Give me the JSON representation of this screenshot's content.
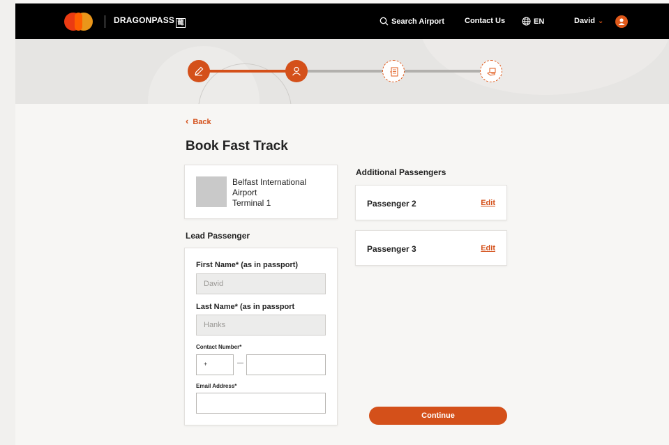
{
  "brand": {
    "name": "DRAGONPASS",
    "badge": "龍"
  },
  "nav": {
    "search_label": "Search Airport",
    "contact_label": "Contact Us",
    "language_label": "EN",
    "user_label": "David"
  },
  "stepper": {
    "steps": [
      {
        "icon": "pencil-icon",
        "state": "done"
      },
      {
        "icon": "person-icon",
        "state": "active"
      },
      {
        "icon": "document-icon",
        "state": "pending"
      },
      {
        "icon": "payment-icon",
        "state": "pending"
      }
    ],
    "accent_color": "#d4501a"
  },
  "page": {
    "back_label": "Back",
    "title": "Book Fast Track"
  },
  "airport": {
    "line1": "Belfast International",
    "line2": "Airport",
    "line3": "Terminal 1"
  },
  "lead": {
    "section_label": "Lead Passenger",
    "first_name_label": "First Name* (as in passport)",
    "first_name_value": "David",
    "last_name_label": "Last Name* (as in passport",
    "last_name_value": "Hanks",
    "contact_label": "Contact Number*",
    "contact_code_value": "+",
    "email_label": "Email Address*"
  },
  "additional": {
    "section_label": "Additional Passengers",
    "passengers": [
      {
        "name": "Passenger 2",
        "edit_label": "Edit"
      },
      {
        "name": "Passenger 3",
        "edit_label": "Edit"
      }
    ]
  },
  "continue_label": "Continue"
}
